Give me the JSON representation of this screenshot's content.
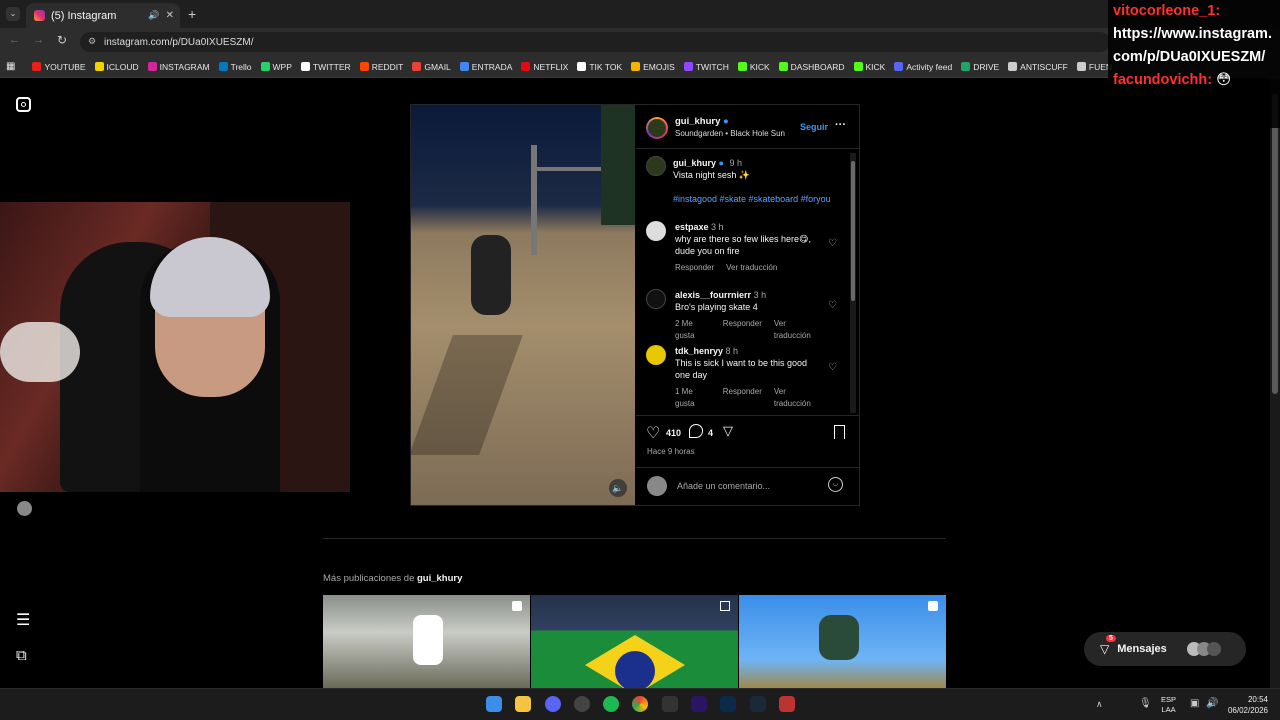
{
  "browser": {
    "tab_title": "(5) Instagram",
    "url": "instagram.com/p/DUa0IXUESZM/",
    "bookmarks": [
      "YOUTUBE",
      "ICLOUD",
      "INSTAGRAM",
      "Trello",
      "WPP",
      "TWITTER",
      "REDDIT",
      "GMAIL",
      "ENTRADA",
      "NETFLIX",
      "TIK TOK",
      "EMOJIS",
      "TWITCH",
      "KICK",
      "DASHBOARD",
      "KICK",
      "Activity feed",
      "DRIVE",
      "ANTISCUFF",
      "FUEN"
    ],
    "bookmark_colors": [
      "#e62117",
      "#f2d200",
      "#d6249f",
      "#0079bf",
      "#25d366",
      "#ffffff",
      "#ff4500",
      "#ea4335",
      "#4285f4",
      "#e50914",
      "#ffffff",
      "#f4b400",
      "#9146ff",
      "#53fc18",
      "#53fc18",
      "#53fc18",
      "#5865f2",
      "#1fa463",
      "#cccccc",
      "#cccccc"
    ]
  },
  "post": {
    "username": "gui_khury",
    "song": "Soundgarden • Black Hole Sun",
    "follow": "Seguir",
    "caption_user": "gui_khury",
    "caption_time": "9 h",
    "caption_text": "Vista night sesh ✨",
    "hashtags": "#instagood #skate #skateboard #foryou",
    "comments": [
      {
        "user": "estpaxe",
        "time": "3 h",
        "text": "why are there so few likes here😋, dude you on fire",
        "likes": "",
        "reply": "Responder",
        "translate": "Ver traducción"
      },
      {
        "user": "alexis__fourrnierr",
        "time": "3 h",
        "text": "Bro's playing skate 4",
        "likes": "2 Me gusta",
        "reply": "Responder",
        "translate": "Ver traducción"
      },
      {
        "user": "tdk_henryy",
        "time": "8 h",
        "text": "This is sick I want to be this good one day",
        "likes": "1 Me gusta",
        "reply": "Responder",
        "translate": "Ver traducción"
      }
    ],
    "like_count": "410",
    "comment_count": "4",
    "posted": "Hace 9 horas",
    "comment_placeholder": "Añade un comentario..."
  },
  "more": {
    "label": "Más publicaciones de",
    "user": "gui_khury"
  },
  "messages": {
    "label": "Mensajes",
    "badge": "5"
  },
  "stream_chat": {
    "lines": [
      {
        "user": "vitocorleone_1:",
        "text": ""
      },
      {
        "user": "",
        "text": "https://www.instagram.com/p/DUa0IXUESZM/"
      },
      {
        "user": "facundovichh:",
        "text": "😳"
      }
    ],
    "user_color": "#ff3030"
  },
  "taskbar": {
    "lang1": "ESP",
    "lang2": "LAA",
    "time": "20:54",
    "date": "06/02/2026"
  }
}
